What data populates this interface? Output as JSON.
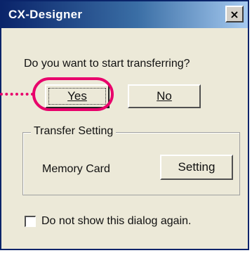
{
  "window": {
    "title": "CX-Designer",
    "close_glyph": "×"
  },
  "dialog": {
    "question": "Do you want to start transferring?",
    "yes_label": "Yes",
    "no_label": "No",
    "transfer_group_label": "Transfer Setting",
    "memory_card_label": "Memory Card",
    "setting_button_label": "Setting",
    "dont_show_label": "Do not show this dialog again.",
    "dont_show_checked": false
  },
  "colors": {
    "titlebar_start": "#0a246a",
    "titlebar_end": "#a6caf0",
    "dialog_bg": "#ece9d8",
    "highlight": "#e8006b"
  },
  "icons": {
    "close": "close-icon"
  }
}
